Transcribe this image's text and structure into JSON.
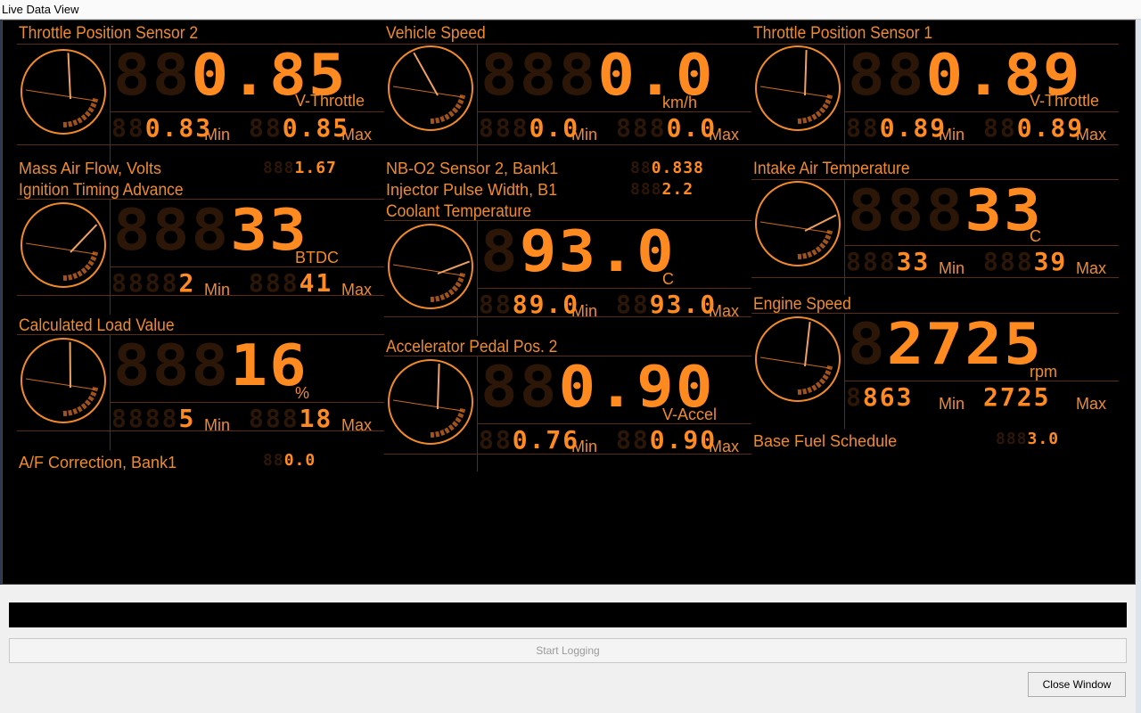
{
  "window": {
    "title": "Live Data View"
  },
  "gauges": {
    "tps2": {
      "label": "Throttle Position Sensor 2",
      "value": "0.85",
      "unit": "V-Throttle",
      "min": "0.83",
      "max": "0.85",
      "min_label": "Min",
      "max_label": "Max"
    },
    "vspd": {
      "label": "Vehicle Speed",
      "value": "0.0",
      "unit": "km/h",
      "min": "0.0",
      "max": "0.0",
      "min_label": "Min",
      "max_label": "Max"
    },
    "tps1": {
      "label": "Throttle Position Sensor 1",
      "value": "0.89",
      "unit": "V-Throttle",
      "min": "0.89",
      "max": "0.89",
      "min_label": "Min",
      "max_label": "Max"
    },
    "ign": {
      "label": "Ignition Timing Advance",
      "value": "33",
      "unit": "BTDC",
      "min": "2",
      "max": "41",
      "min_label": "Min",
      "max_label": "Max"
    },
    "cool": {
      "label": "Coolant Temperature",
      "value": "93.0",
      "unit": "C",
      "min": "89.0",
      "max": "93.0",
      "min_label": "Min",
      "max_label": "Max"
    },
    "iat": {
      "label": "Intake Air Temperature",
      "value": "33",
      "unit": "C",
      "min": "33",
      "max": "39",
      "min_label": "Min",
      "max_label": "Max"
    },
    "load": {
      "label": "Calculated Load Value",
      "value": "16",
      "unit": "%",
      "min": "5",
      "max": "18",
      "min_label": "Min",
      "max_label": "Max"
    },
    "app2": {
      "label": "Accelerator Pedal Pos. 2",
      "value": "0.90",
      "unit": "V-Accel",
      "min": "0.76",
      "max": "0.90",
      "min_label": "Min",
      "max_label": "Max"
    },
    "rpm": {
      "label": "Engine Speed",
      "value": "2725",
      "unit": "rpm",
      "min": "863",
      "max": "2725",
      "min_label": "Min",
      "max_label": "Max"
    }
  },
  "readouts": {
    "maf": {
      "label": "Mass Air Flow, Volts",
      "value": "1.67"
    },
    "o2": {
      "label": "NB-O2 Sensor 2, Bank1",
      "value": "0.838"
    },
    "inj": {
      "label": "Injector Pulse Width, B1",
      "value": "2.2"
    },
    "afc": {
      "label": "A/F Correction, Bank1",
      "value": "0.0"
    },
    "bfs": {
      "label": "Base Fuel Schedule",
      "value": "3.0"
    }
  },
  "footer": {
    "start_logging": "Start Logging",
    "close_window": "Close Window"
  },
  "colors": {
    "accent": "#f28a2a",
    "digit": "#ff8a1f",
    "ghost": "#2c1608",
    "background": "#000000"
  },
  "needles": {
    "tps2": 0.36,
    "vspd": 0.24,
    "tps1": 0.38,
    "ign": 0.55,
    "cool": 0.64,
    "iat": 0.62,
    "load": 0.37,
    "app2": 0.38,
    "rpm": 0.4
  }
}
